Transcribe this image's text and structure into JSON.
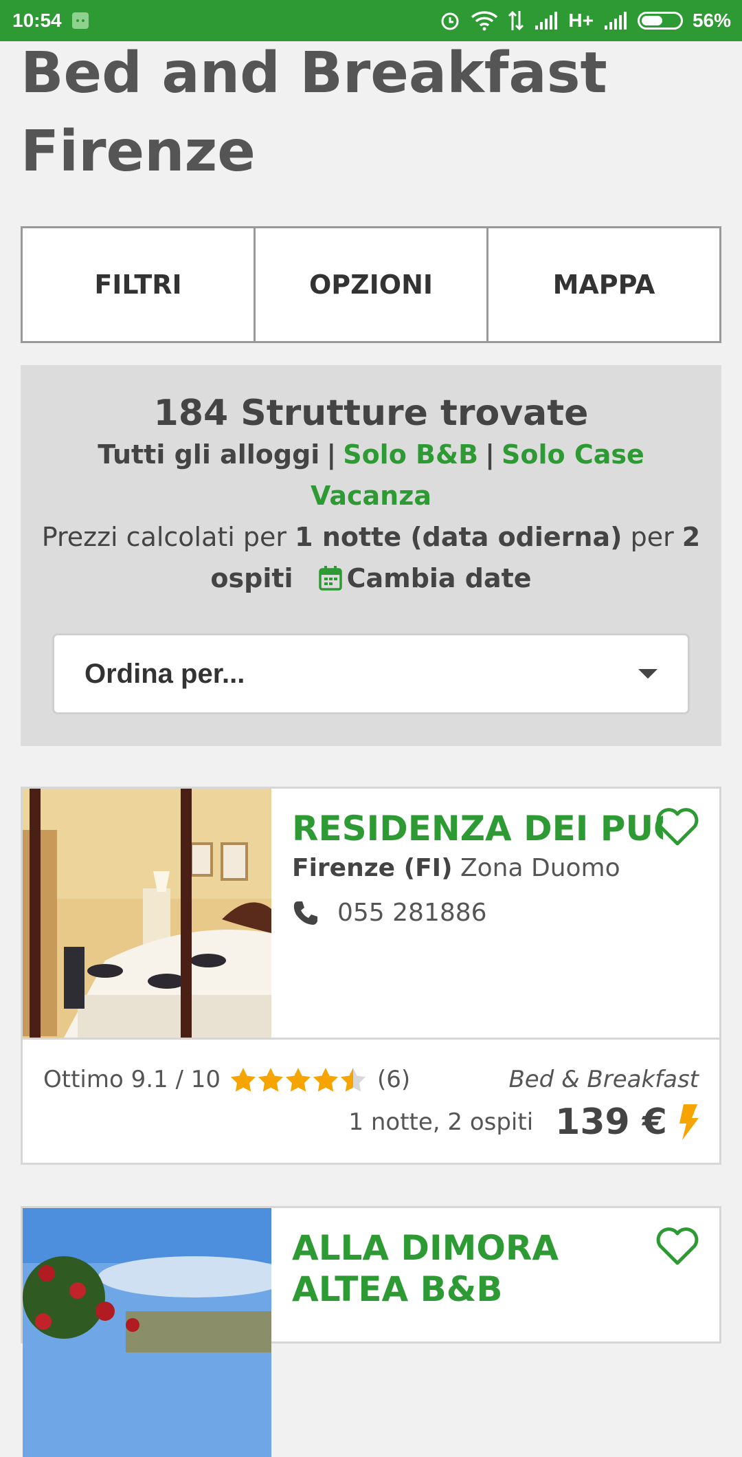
{
  "status_bar": {
    "time": "10:54",
    "network": "H+",
    "battery": "56%",
    "battery_level": 0.56,
    "icons": [
      "android-icon",
      "alarm-icon",
      "wifi-icon",
      "data-arrows-icon",
      "signal-icon",
      "signal-icon",
      "battery-icon"
    ]
  },
  "page": {
    "title": "Bed and Breakfast Firenze"
  },
  "tabs": [
    {
      "label": "FILTRI"
    },
    {
      "label": "OPZIONI"
    },
    {
      "label": "MAPPA"
    }
  ],
  "summary": {
    "count_text": "184 Strutture trovate",
    "filter_all": "Tutti gli alloggi",
    "separator": "|",
    "filter_bb": "Solo B&B",
    "filter_case": "Solo Case Vacanza",
    "prices_prefix": "Prezzi calcolati per",
    "prices_nights": "1 notte (data odierna)",
    "prices_mid": "per",
    "prices_guests": "2 ospiti",
    "change_dates": "Cambia date"
  },
  "sort": {
    "label": "Ordina per..."
  },
  "listings": [
    {
      "name": "RESIDENZA DEI PUCCI",
      "city": "Firenze (FI)",
      "zone": "Zona Duomo",
      "phone": "055 281886",
      "rating_label": "Ottimo 9.1 / 10",
      "rating_stars": 4.5,
      "reviews": "(6)",
      "type": "Bed & Breakfast",
      "nights_guests": "1 notte, 2 ospiti",
      "price": "139 €"
    },
    {
      "name": "ALLA DIMORA ALTEA B&B"
    }
  ],
  "colors": {
    "brand_green": "#2e9a34",
    "accent_orange": "#f5a400"
  }
}
